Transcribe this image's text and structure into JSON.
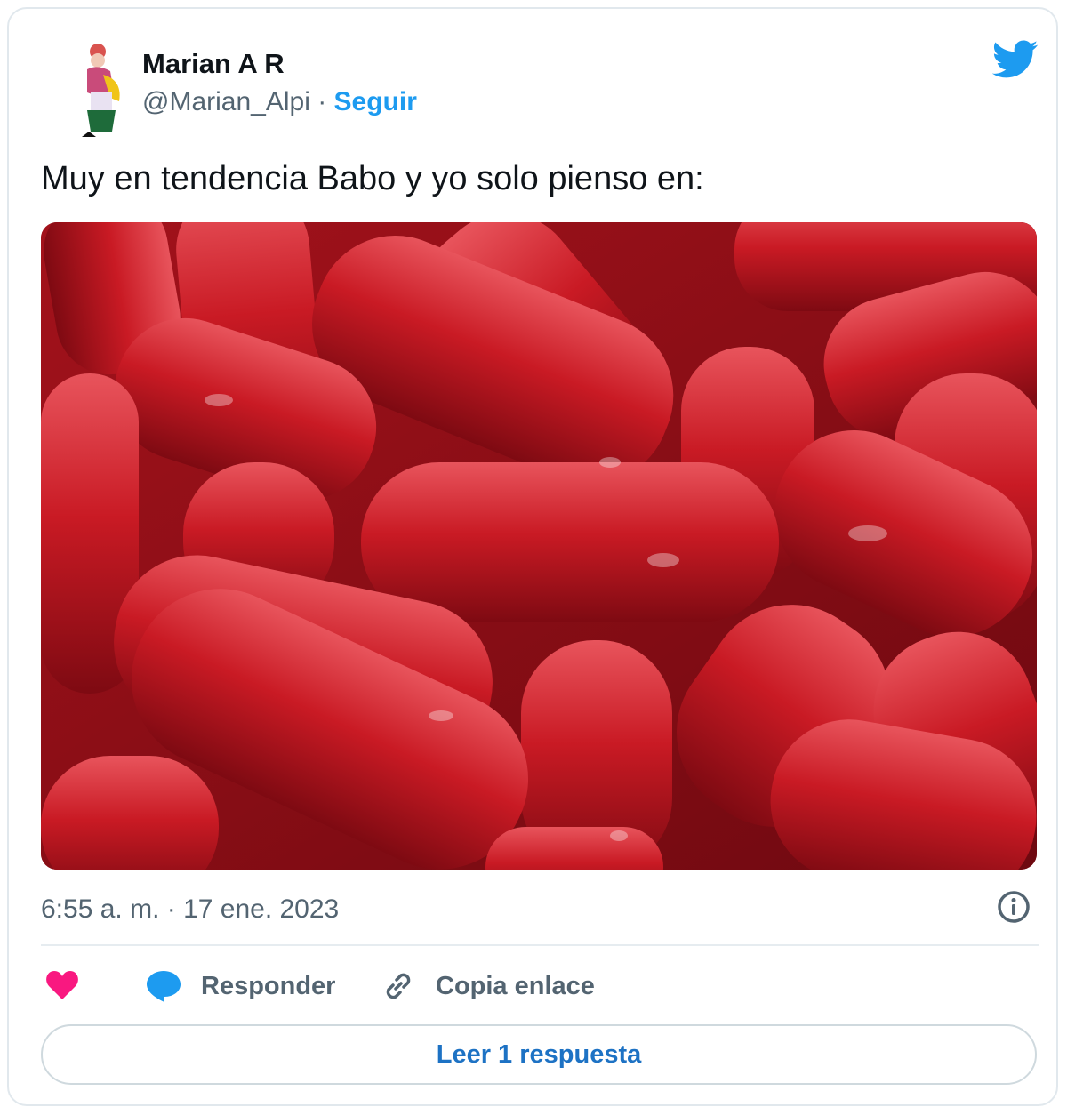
{
  "tweet": {
    "author_name": "Marian A R",
    "handle": "@Marian_Alpi",
    "separator": " · ",
    "follow_label": "Seguir",
    "text": "Muy en tendencia Babo y yo solo pienso en:",
    "timestamp": "6:55 a. m. · 17 ene. 2023",
    "media_description": "red-jelly-candy-photo",
    "avatar_icon": "avatar-illustration",
    "logo_icon": "twitter-bird-icon"
  },
  "actions": {
    "like_icon": "heart-icon",
    "reply_icon": "speech-bubble-icon",
    "reply_label": "Responder",
    "copy_icon": "link-icon",
    "copy_label": "Copia enlace",
    "read_replies_label": "Leer 1 respuesta"
  },
  "colors": {
    "accent": "#1d9bf0",
    "like": "#f91880",
    "text_primary": "#0f1419",
    "text_secondary": "#536471",
    "candy_red": "#c4161f"
  }
}
